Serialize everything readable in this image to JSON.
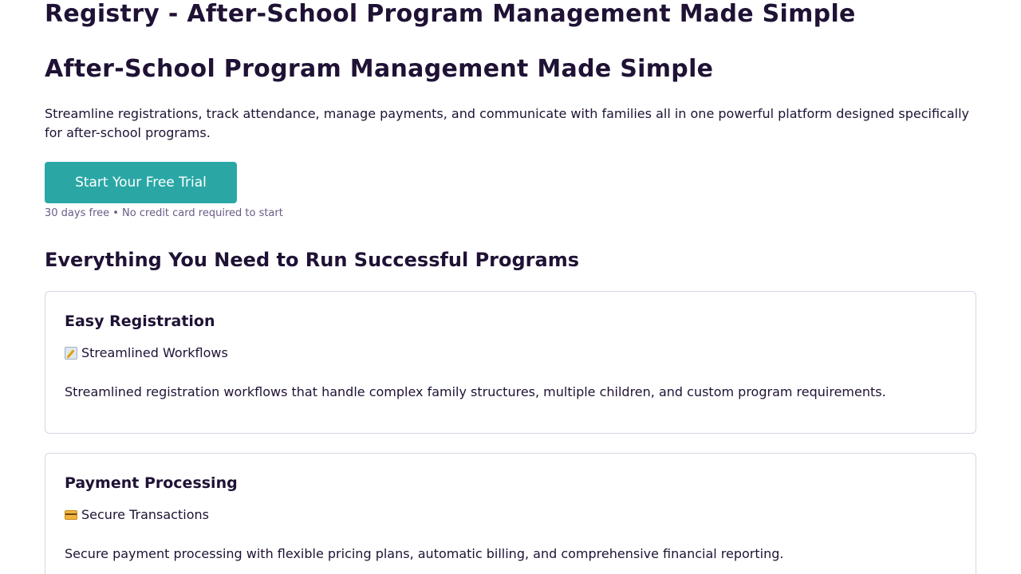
{
  "header": {
    "site_title": "Registry - After-School Program Management Made Simple"
  },
  "hero": {
    "title": "After-School Program Management Made Simple",
    "description": "Streamline registrations, track attendance, manage payments, and communicate with families all in one powerful platform designed specifically for after-school programs.",
    "cta_label": "Start Your Free Trial",
    "cta_note": "30 days free • No credit card required to start"
  },
  "features": {
    "section_title": "Everything You Need to Run Successful Programs",
    "items": [
      {
        "title": "Easy Registration",
        "icon": "memo-icon",
        "tagline": "Streamlined Workflows",
        "description": "Streamlined registration workflows that handle complex family structures, multiple children, and custom program requirements."
      },
      {
        "title": "Payment Processing",
        "icon": "credit-card-icon",
        "tagline": "Secure Transactions",
        "description": "Secure payment processing with flexible pricing plans, automatic billing, and comprehensive financial reporting."
      }
    ]
  },
  "colors": {
    "text": "#1f1235",
    "accent": "#2aa7a5",
    "muted": "#6b5a86",
    "border": "#d9d4e3"
  }
}
